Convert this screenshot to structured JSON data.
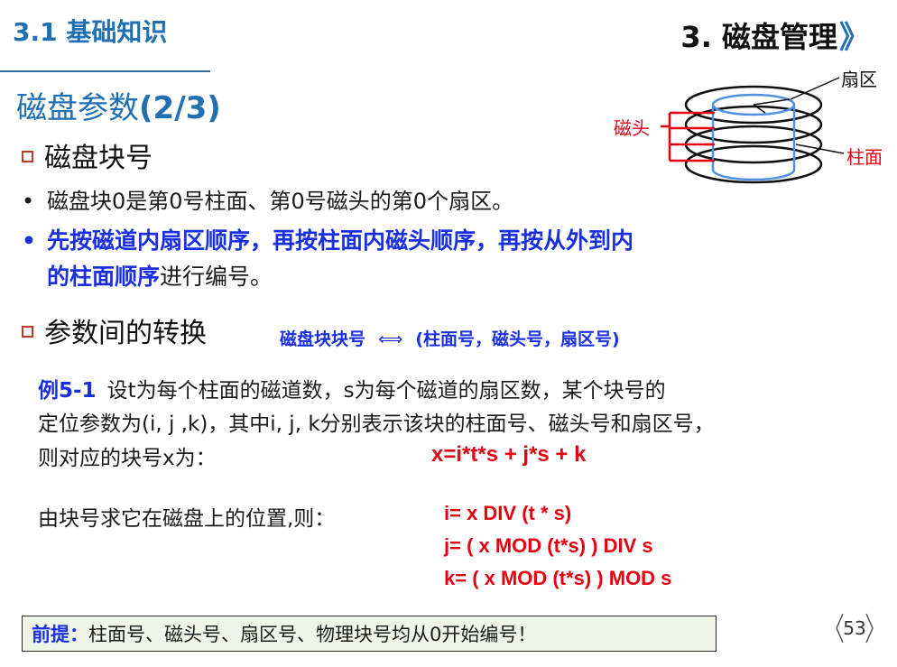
{
  "header": {
    "section_title": "3.1 基础知识",
    "chapter_title": "3. 磁盘管理",
    "chapter_arrow": "》"
  },
  "subtitle": {
    "text": "磁盘参数",
    "paren": "(2/3)"
  },
  "diagram": {
    "label_sector": "扇区",
    "label_head": "磁头",
    "label_cylinder": "柱面"
  },
  "section1": {
    "heading": "磁盘块号",
    "bullet1": "磁盘块0是第0号柱面、第0号磁头的第0个扇区。",
    "bullet2_blue": "先按磁道内扇区顺序，再按柱面内磁头顺序，再按从外到内",
    "bullet2_blue_line2": "的柱面顺序",
    "bullet2_rest": "进行编号。"
  },
  "section2": {
    "heading": "参数间的转换",
    "mapping_left": "磁盘块块号",
    "mapping_arrow": "⟺",
    "mapping_right": "(柱面号，磁头号，扇区号)"
  },
  "example": {
    "label": "例5-1",
    "line1": "设t为每个柱面的磁道数，s为每个磁道的扇区数，某个块号的",
    "line2": "定位参数为(i, j ,k)，其中i, j, k分别表示该块的柱面号、磁头号和扇区号，",
    "line3": "则对应的块号x为：",
    "formula": "x=i*t*s + j*s + k"
  },
  "position": {
    "text": "由块号求它在磁盘上的位置,则：",
    "f1": "i= x DIV (t * s)",
    "f2": "j= ( x MOD (t*s) ) DIV s",
    "f3": "k= ( x MOD (t*s) ) MOD s"
  },
  "premise": {
    "label": "前提：",
    "text": "柱面号、磁头号、扇区号、物理块号均从0开始编号！"
  },
  "page_number": "53",
  "colors": {
    "blue_title": "#1f6fb2",
    "bright_blue": "#1a2fe0",
    "red": "#e60012"
  }
}
